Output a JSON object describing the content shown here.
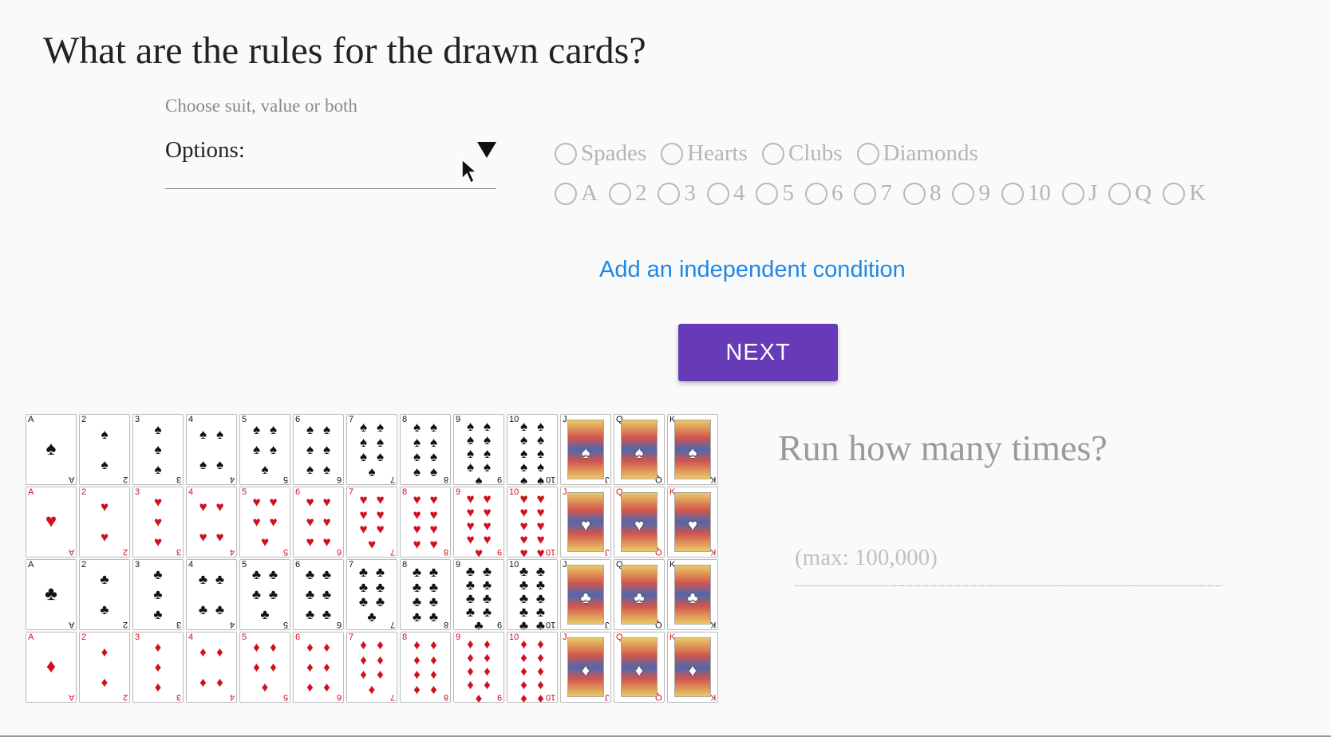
{
  "question": {
    "title": "What are the rules for the drawn cards?",
    "hint": "Choose suit, value or both",
    "select_label": "Options:"
  },
  "suits": [
    "Spades",
    "Hearts",
    "Clubs",
    "Diamonds"
  ],
  "ranks": [
    "A",
    "2",
    "3",
    "4",
    "5",
    "6",
    "7",
    "8",
    "9",
    "10",
    "J",
    "Q",
    "K"
  ],
  "add_condition_label": "Add an independent condition",
  "next_label": "NEXT",
  "deck": {
    "rows": [
      {
        "suit": "spades",
        "symbol": "♠",
        "color": "#111111"
      },
      {
        "suit": "hearts",
        "symbol": "♥",
        "color": "#d0101e"
      },
      {
        "suit": "clubs",
        "symbol": "♣",
        "color": "#111111"
      },
      {
        "suit": "diamonds",
        "symbol": "♦",
        "color": "#d0101e"
      }
    ],
    "ranks": [
      "A",
      "2",
      "3",
      "4",
      "5",
      "6",
      "7",
      "8",
      "9",
      "10",
      "J",
      "Q",
      "K"
    ]
  },
  "run": {
    "title": "Run how many times?",
    "placeholder": "(max: 100,000)"
  },
  "colors": {
    "accent": "#673ab7",
    "link": "#1e88e5"
  },
  "icons": {
    "dropdown": "triangle-down-icon",
    "cursor": "mouse-pointer-icon",
    "radio": "radio-circle-icon"
  }
}
